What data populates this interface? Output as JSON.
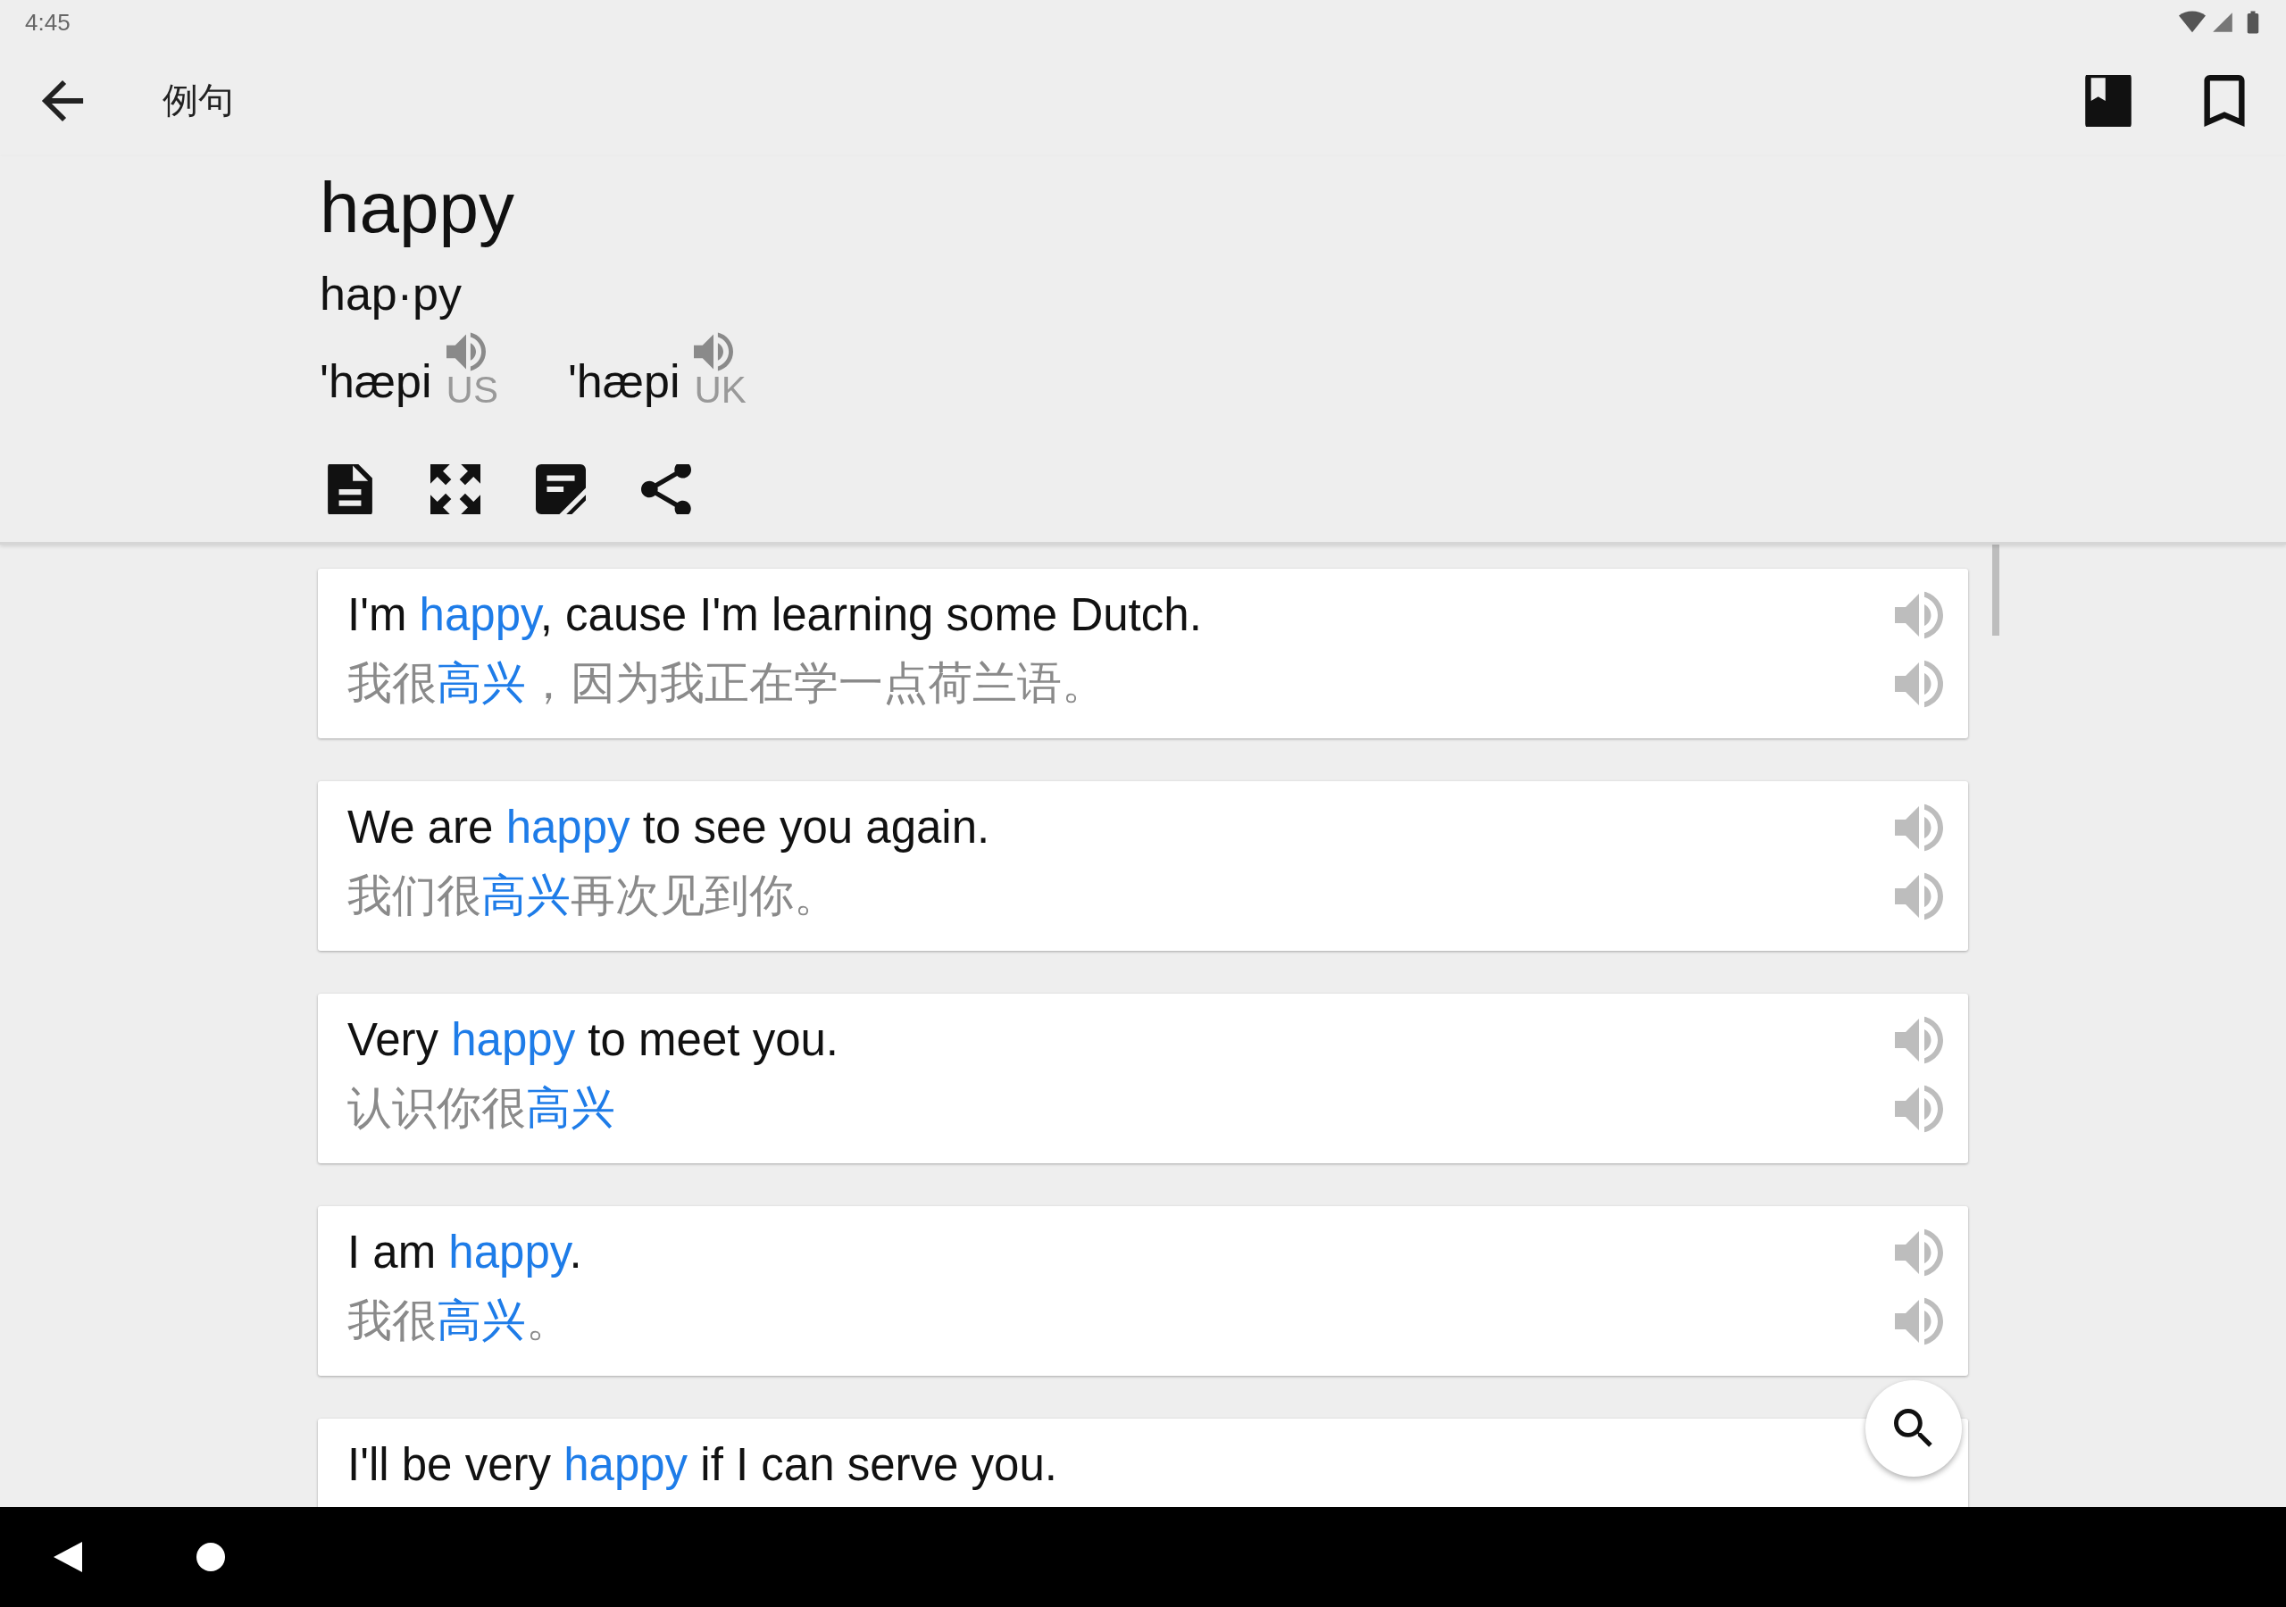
{
  "status_bar": {
    "time": "4:45"
  },
  "toolbar": {
    "title": "例句"
  },
  "entry": {
    "word": "happy",
    "syllables": "hap·py",
    "pronunciations": [
      {
        "phonetic": "'hæpi",
        "region": "US"
      },
      {
        "phonetic": "'hæpi",
        "region": "UK"
      }
    ]
  },
  "examples": [
    {
      "english": [
        {
          "text": "I'm ",
          "highlight": false
        },
        {
          "text": "happy",
          "highlight": true
        },
        {
          "text": ", cause I'm learning some Dutch.",
          "highlight": false
        }
      ],
      "chinese": [
        {
          "text": "我很",
          "highlight": false
        },
        {
          "text": "高兴",
          "highlight": true
        },
        {
          "text": "，因为我正在学一点荷兰语。",
          "highlight": false
        }
      ]
    },
    {
      "english": [
        {
          "text": "We are ",
          "highlight": false
        },
        {
          "text": "happy",
          "highlight": true
        },
        {
          "text": " to see you again.",
          "highlight": false
        }
      ],
      "chinese": [
        {
          "text": "我们很",
          "highlight": false
        },
        {
          "text": "高兴",
          "highlight": true
        },
        {
          "text": "再次见到你。",
          "highlight": false
        }
      ]
    },
    {
      "english": [
        {
          "text": "Very ",
          "highlight": false
        },
        {
          "text": "happy",
          "highlight": true
        },
        {
          "text": " to meet you.",
          "highlight": false
        }
      ],
      "chinese": [
        {
          "text": "认识你很",
          "highlight": false
        },
        {
          "text": "高兴",
          "highlight": true
        }
      ]
    },
    {
      "english": [
        {
          "text": "I am ",
          "highlight": false
        },
        {
          "text": "happy",
          "highlight": true
        },
        {
          "text": ".",
          "highlight": false
        }
      ],
      "chinese": [
        {
          "text": "我很",
          "highlight": false
        },
        {
          "text": "高兴",
          "highlight": true
        },
        {
          "text": "。",
          "highlight": false
        }
      ]
    },
    {
      "english": [
        {
          "text": "I'll be very ",
          "highlight": false
        },
        {
          "text": "happy",
          "highlight": true
        },
        {
          "text": " if I can serve you.",
          "highlight": false
        }
      ]
    }
  ]
}
